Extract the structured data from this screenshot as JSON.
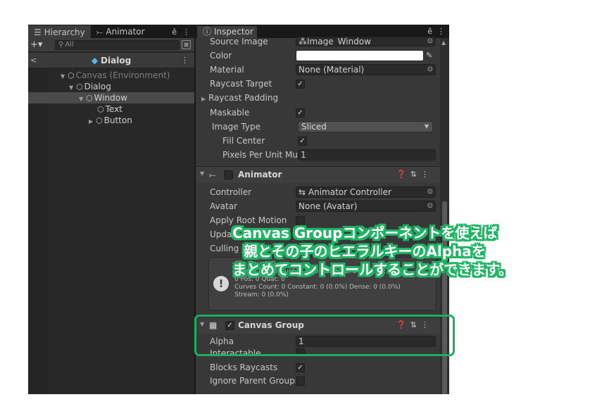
{
  "hierarchy": {
    "tab_label": "Hierarchy",
    "animator_tab_label": "Animator",
    "search_placeholder": "All",
    "breadcrumb_title": "Dialog",
    "tree": [
      {
        "label": "Canvas (Environment)",
        "state": "dim"
      },
      {
        "label": "Dialog",
        "state": "normal"
      },
      {
        "label": "Window",
        "state": "selected"
      },
      {
        "label": "Text",
        "state": "normal"
      },
      {
        "label": "Button",
        "state": "normal"
      }
    ]
  },
  "inspector": {
    "tab_label": "Inspector",
    "image": {
      "source_image_label": "Source Image",
      "source_image_value": "Image_Window",
      "color_label": "Color",
      "color_value": "#ffffff",
      "material_label": "Material",
      "material_value": "None (Material)",
      "raycast_target_label": "Raycast Target",
      "raycast_target": true,
      "raycast_padding_label": "Raycast Padding",
      "maskable_label": "Maskable",
      "maskable": true,
      "image_type_label": "Image Type",
      "image_type_value": "Sliced",
      "fill_center_label": "Fill Center",
      "fill_center": true,
      "pixels_per_unit_label": "Pixels Per Unit Mul",
      "pixels_per_unit_value": "1"
    },
    "animator": {
      "name": "Animator",
      "controller_label": "Controller",
      "controller_value": "Animator Controller",
      "avatar_label": "Avatar",
      "avatar_value": "None (Avatar)",
      "apply_root_motion_label": "Apply Root Motion",
      "update_mode_label": "Update M",
      "culling_mode_label": "Culling M",
      "info_lines": [
        "Clip Count: 0",
        "Curves Pos: 0 Quat: 0 Euler: 0 Scale: 0 Muscles: 0",
        "0 Pos: 0 Quat: 0",
        "Curves Count: 0 Constant: 0 (0.0%) Dense: 0 (0.0%)",
        "Stream: 0 (0.0%)"
      ]
    },
    "canvas_group": {
      "name": "Canvas Group",
      "alpha_label": "Alpha",
      "alpha_value": "1",
      "interactable_label": "Interactable",
      "blocks_raycasts_label": "Blocks Raycasts",
      "blocks_raycasts": true,
      "ignore_parent_groups_label": "Ignore Parent Groups",
      "ignore_parent_groups": false
    }
  },
  "annotation": {
    "line1": "Canvas Groupコンポーネントを使えば",
    "line2": "親とその子のヒエラルキーのAlphaを",
    "line3": "まとめてコントロールすることができます。"
  },
  "colors": {
    "highlight": "#1dad63",
    "selection": "#4a4a4a",
    "panel_bg": "#383838"
  }
}
